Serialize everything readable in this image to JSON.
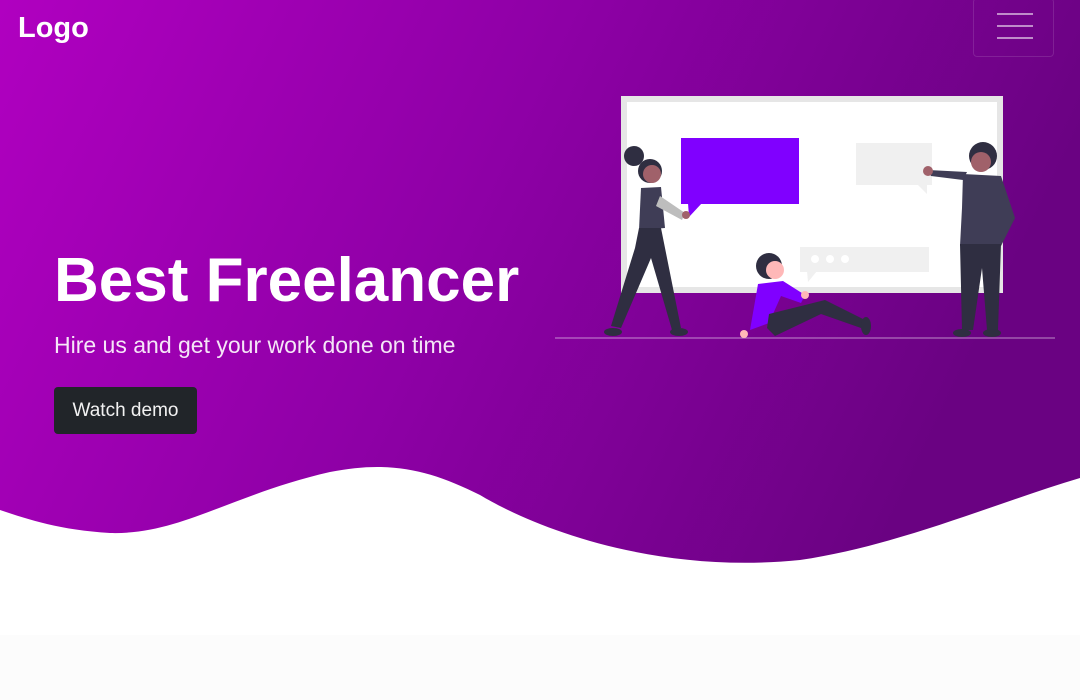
{
  "navbar": {
    "logo": "Logo",
    "menu_icon": "hamburger-menu-icon"
  },
  "hero": {
    "title": "Best Freelancer",
    "subtitle": "Hire us and get your work done on time",
    "cta_label": "Watch demo",
    "illustration_icon": "team-presentation-illustration"
  },
  "colors": {
    "gradient_start": "#b000c0",
    "gradient_mid": "#8e00a6",
    "gradient_end": "#6a0282",
    "accent": "#8000ff",
    "button_bg": "#212529",
    "page_bg": "#ffffff"
  }
}
